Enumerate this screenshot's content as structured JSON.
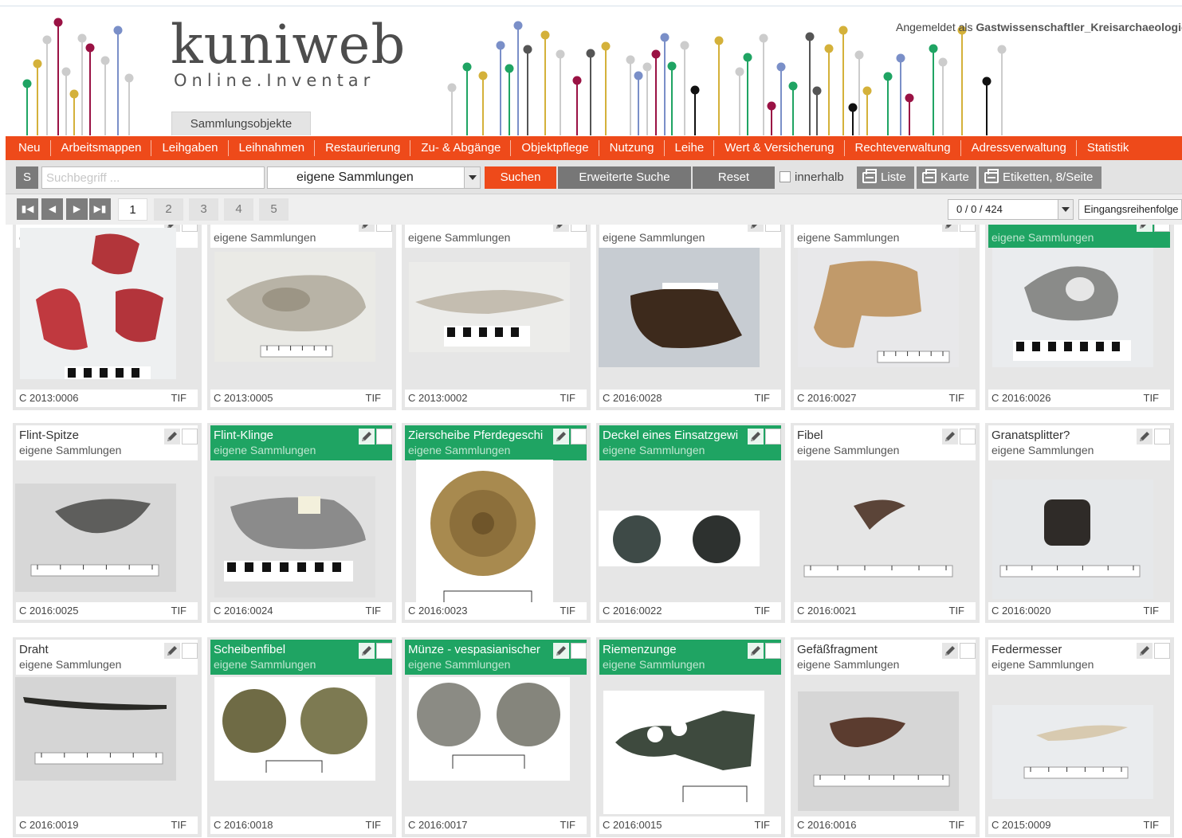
{
  "header": {
    "logo": "kuniweb",
    "logo_sub": "Online.Inventar",
    "tab": "Sammlungsobjekte",
    "login_prefix": "Angemeldet als",
    "login_user": "Gastwissenschaftler_Kreisarchaeologie"
  },
  "colors": {
    "accent": "#ee4a1a",
    "highlight": "#1fa463",
    "toolbar": "#e3e3e3"
  },
  "nav": [
    "Neu",
    "Arbeitsmappen",
    "Leihgaben",
    "Leihnahmen",
    "Restaurierung",
    "Zu- & Abgänge",
    "Objektpflege",
    "Nutzung",
    "Leihe",
    "Wert & Versicherung",
    "Rechteverwaltung",
    "Adressverwaltung",
    "Statistik"
  ],
  "toolbar": {
    "s_label": "S",
    "search_placeholder": "Suchbegriff ...",
    "collection_select": "eigene Sammlungen",
    "search": "Suchen",
    "advanced": "Erweiterte Suche",
    "reset": "Reset",
    "within": "innerhalb",
    "list": "Liste",
    "card": "Karte",
    "labels": "Etiketten, 8/Seite"
  },
  "pager": {
    "pages": [
      "1",
      "2",
      "3",
      "4",
      "5"
    ],
    "current": "1",
    "count": "0 / 0 / 424",
    "sort": "Eingangsreihenfolge"
  },
  "cards": [
    {
      "title": "",
      "collection": "eigene Sammlungen",
      "id": "C 2013:0006",
      "format": "TIF",
      "highlighted": false
    },
    {
      "title": "",
      "collection": "eigene Sammlungen",
      "id": "C 2013:0005",
      "format": "TIF",
      "highlighted": false
    },
    {
      "title": "",
      "collection": "eigene Sammlungen",
      "id": "C 2013:0002",
      "format": "TIF",
      "highlighted": false
    },
    {
      "title": "",
      "collection": "eigene Sammlungen",
      "id": "C 2016:0028",
      "format": "TIF",
      "highlighted": false
    },
    {
      "title": "",
      "collection": "eigene Sammlungen",
      "id": "C 2016:0027",
      "format": "TIF",
      "highlighted": false
    },
    {
      "title": "",
      "collection": "eigene Sammlungen",
      "id": "C 2016:0026",
      "format": "TIF",
      "highlighted": true
    },
    {
      "title": "Flint-Spitze",
      "collection": "eigene Sammlungen",
      "id": "C 2016:0025",
      "format": "TIF",
      "highlighted": false
    },
    {
      "title": "Flint-Klinge",
      "collection": "eigene Sammlungen",
      "id": "C 2016:0024",
      "format": "TIF",
      "highlighted": true
    },
    {
      "title": "Zierscheibe Pferdegeschi",
      "collection": "eigene Sammlungen",
      "id": "C 2016:0023",
      "format": "TIF",
      "highlighted": true
    },
    {
      "title": "Deckel eines Einsatzgewi",
      "collection": "eigene Sammlungen",
      "id": "C 2016:0022",
      "format": "TIF",
      "highlighted": true
    },
    {
      "title": "Fibel",
      "collection": "eigene Sammlungen",
      "id": "C 2016:0021",
      "format": "TIF",
      "highlighted": false
    },
    {
      "title": "Granatsplitter?",
      "collection": "eigene Sammlungen",
      "id": "C 2016:0020",
      "format": "TIF",
      "highlighted": false
    },
    {
      "title": "Draht",
      "collection": "eigene Sammlungen",
      "id": "C 2016:0019",
      "format": "TIF",
      "highlighted": false
    },
    {
      "title": "Scheibenfibel",
      "collection": "eigene Sammlungen",
      "id": "C 2016:0018",
      "format": "TIF",
      "highlighted": true
    },
    {
      "title": "Münze - vespasianischer",
      "collection": "eigene Sammlungen",
      "id": "C 2016:0017",
      "format": "TIF",
      "highlighted": true
    },
    {
      "title": "Riemenzunge",
      "collection": "eigene Sammlungen",
      "id": "C 2016:0015",
      "format": "TIF",
      "highlighted": true
    },
    {
      "title": "Gefäßfragment",
      "collection": "eigene Sammlungen",
      "id": "C 2016:0016",
      "format": "TIF",
      "highlighted": false
    },
    {
      "title": "Federmesser",
      "collection": "eigene Sammlungen",
      "id": "C 2015:0009",
      "format": "TIF",
      "highlighted": false
    }
  ]
}
